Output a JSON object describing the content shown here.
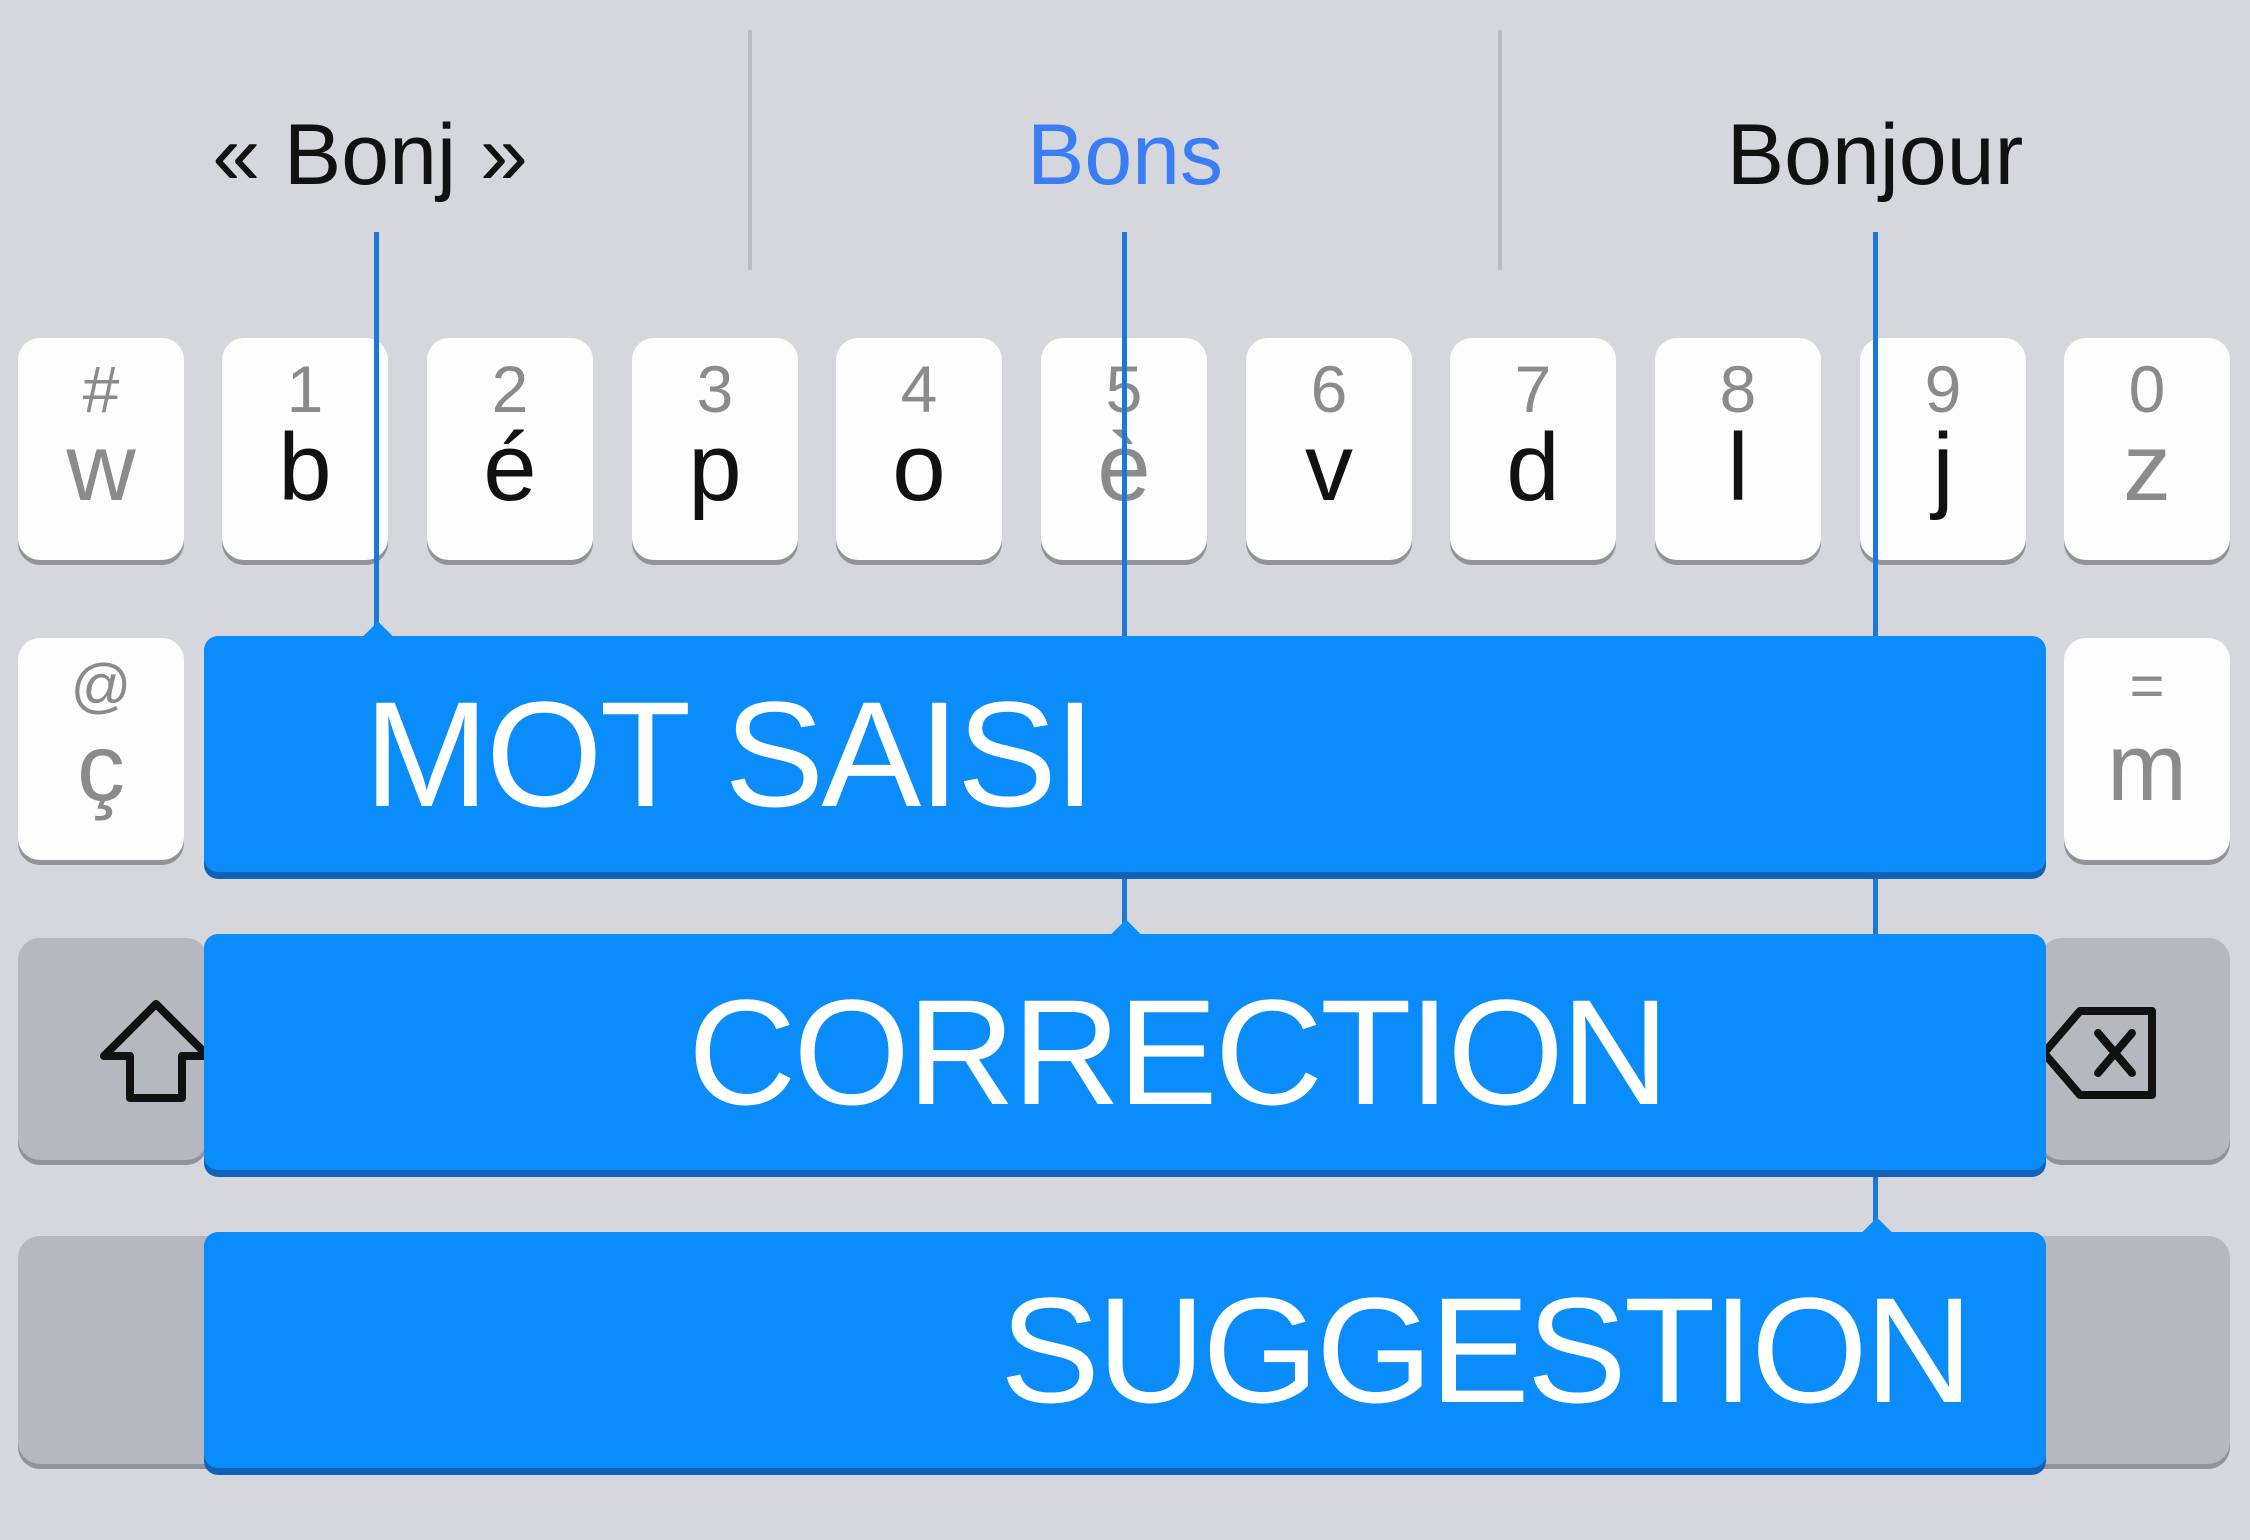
{
  "predictions": {
    "typed": "« Bonj »",
    "correction": "Bons",
    "suggestion": "Bonjour"
  },
  "row1": [
    {
      "alt": "#",
      "main": "w"
    },
    {
      "alt": "1",
      "main": "b"
    },
    {
      "alt": "2",
      "main": "é"
    },
    {
      "alt": "3",
      "main": "p"
    },
    {
      "alt": "4",
      "main": "o"
    },
    {
      "alt": "5",
      "main": "è"
    },
    {
      "alt": "6",
      "main": "v"
    },
    {
      "alt": "7",
      "main": "d"
    },
    {
      "alt": "8",
      "main": "l"
    },
    {
      "alt": "9",
      "main": "j"
    },
    {
      "alt": "0",
      "main": "z"
    }
  ],
  "row2_left": {
    "alt": "@",
    "main": "ç"
  },
  "row2_right": {
    "alt": "=",
    "main": "m"
  },
  "callouts": {
    "typed": "MOT SAISI",
    "correction": "CORRECTION",
    "suggestion": "SUGGESTION"
  },
  "icons": {
    "shift": "shift-icon",
    "backspace": "backspace-icon"
  },
  "colors": {
    "callout": "#0a8cfb",
    "correction_text": "#3a7df4",
    "keyboard_bg": "#d5d7dc"
  }
}
